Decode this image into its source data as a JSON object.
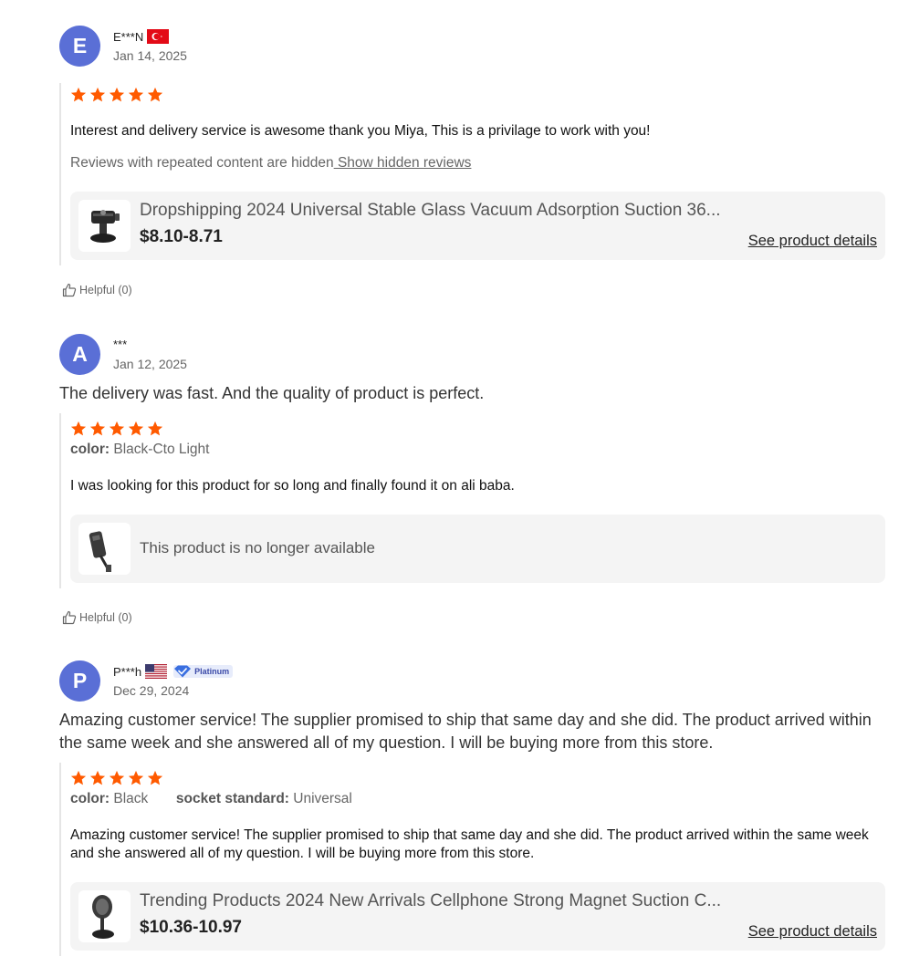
{
  "reviews": [
    {
      "avatar_letter": "E",
      "username": "E***N",
      "country_flag": "turkey-flag-icon",
      "date": "Jan 14, 2025",
      "headline": "",
      "rating": 5,
      "attributes": [],
      "text": "Interest and delivery service is awesome thank you Miya, This is a privilage to work with you!",
      "hidden_notice": "Reviews with repeated content are hidden",
      "hidden_link": " Show hidden reviews",
      "product": {
        "name": "Dropshipping 2024 Universal Stable Glass Vacuum Adsorption Suction 36...",
        "price": "$8.10-8.71",
        "details_link": "See product details"
      },
      "helpful": "Helpful (0)"
    },
    {
      "avatar_letter": "A",
      "username": "***",
      "date": "Jan 12, 2025",
      "headline": "The delivery was fast. And the quality of product is perfect.",
      "rating": 5,
      "attributes": [
        {
          "label": "color:",
          "value": "Black-Cto Light"
        }
      ],
      "text": "I was looking for this product for so long and finally found it on ali baba.",
      "product": {
        "unavailable": "This product is no longer available"
      },
      "helpful": "Helpful (0)"
    },
    {
      "avatar_letter": "P",
      "username": "P***h",
      "country_flag": "usa-flag-icon",
      "tier_badge": "Platinum",
      "date": "Dec 29, 2024",
      "headline": "Amazing customer service! The supplier promised to ship that same day and she did. The product arrived within the same week and she answered all of my question. I will be buying more from this store.",
      "rating": 5,
      "attributes": [
        {
          "label": "color:",
          "value": "Black"
        },
        {
          "label": "socket standard:",
          "value": "Universal"
        }
      ],
      "text": "Amazing customer service! The supplier promised to ship that same day and she did. The product arrived within the same week and she answered all of my question. I will be buying more from this store.",
      "product": {
        "name": "Trending Products 2024 New Arrivals Cellphone Strong Magnet Suction C...",
        "price": "$10.36-10.97",
        "details_link": "See product details"
      }
    }
  ],
  "colors": {
    "avatar": "#5a6fd6",
    "star": "#ff5a00",
    "card_bg": "#f4f4f4"
  }
}
